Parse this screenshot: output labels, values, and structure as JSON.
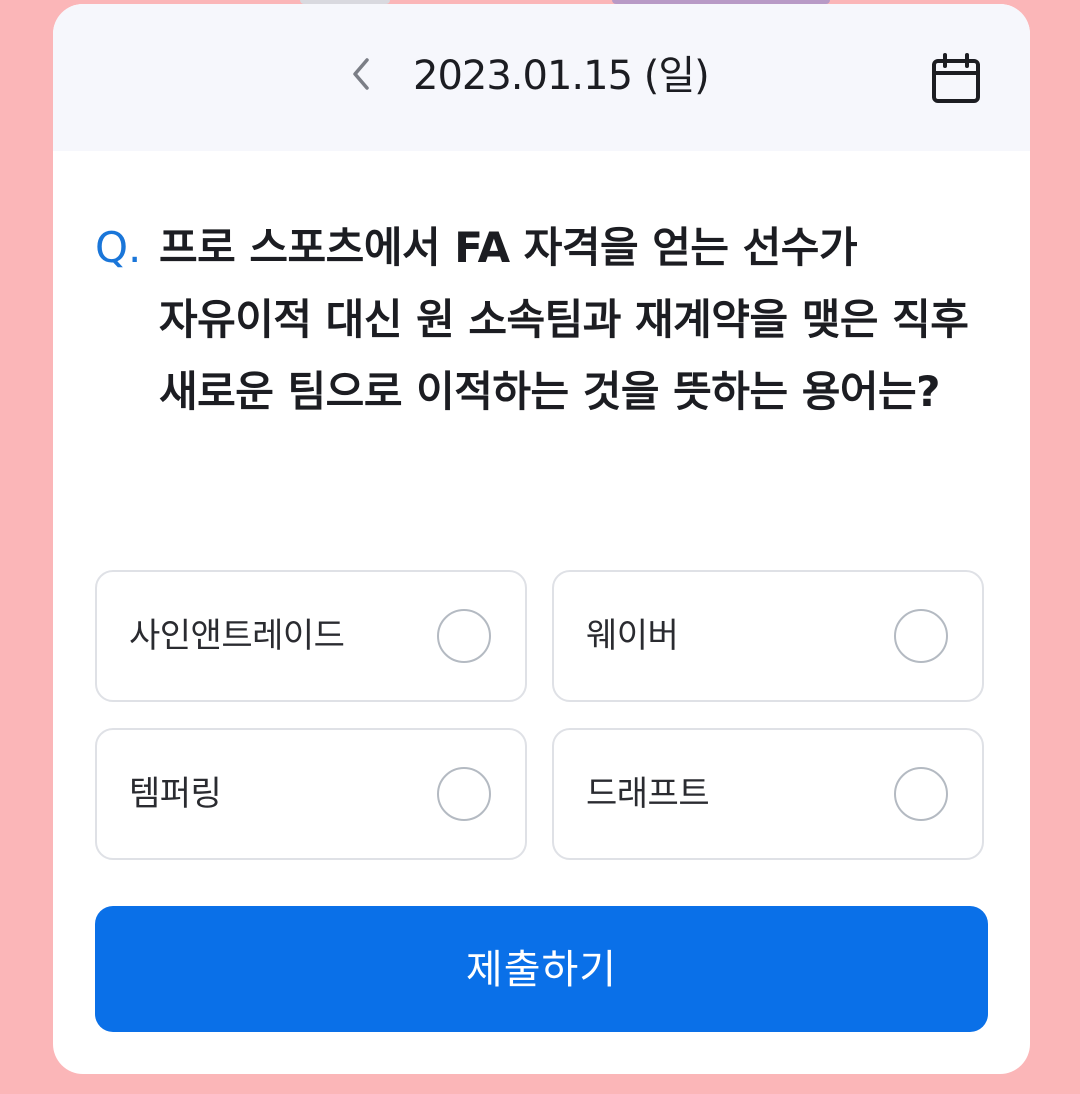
{
  "header": {
    "date": "2023.01.15 (일)",
    "back_icon": "chevron-left-icon",
    "calendar_icon": "calendar-icon"
  },
  "question": {
    "prefix": "Q.",
    "text": "프로 스포츠에서 FA 자격을 얻는 선수가 자유이적 대신 원 소속팀과 재계약을 맺은 직후 새로운 팀으로 이적하는 것을 뜻하는 용어는?"
  },
  "options": [
    {
      "label": "사인앤트레이드",
      "selected": false
    },
    {
      "label": "웨이버",
      "selected": false
    },
    {
      "label": "템퍼링",
      "selected": false
    },
    {
      "label": "드래프트",
      "selected": false
    }
  ],
  "submit": {
    "label": "제출하기"
  },
  "colors": {
    "background": "#fbb6b8",
    "header_bg": "#f6f7fc",
    "accent": "#0a70e8",
    "q_mark": "#1a76d9"
  }
}
